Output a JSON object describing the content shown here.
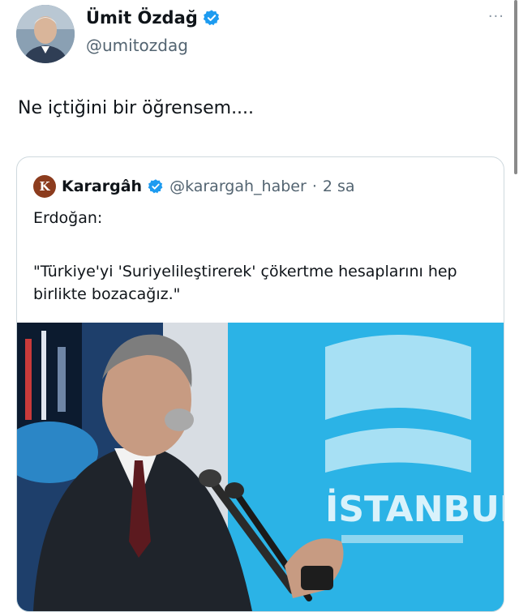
{
  "author": {
    "name": "Ümit Özdağ",
    "handle": "@umitozdag",
    "verified_icon": "verified-badge-icon"
  },
  "more_icon": "···",
  "tweet": {
    "text": "Ne içtiğini bir öğrensem...."
  },
  "quote": {
    "logo_letter": "K",
    "name": "Karargâh",
    "handle": "@karargah_haber",
    "separator": "·",
    "time": "2 sa",
    "line1": "Erdoğan:",
    "line2": "\"Türkiye'yi 'Suriyelileştirerek' çökertme hesaplarını hep birlikte bozacağız.\"",
    "photo_sign_text": "İSTANBUL"
  },
  "colors": {
    "verified_blue": "#1d9bf0",
    "text_primary": "#0f1419",
    "text_secondary": "#536471",
    "border": "#cfd9de",
    "photo_background_blue": "#2ab0e3"
  }
}
